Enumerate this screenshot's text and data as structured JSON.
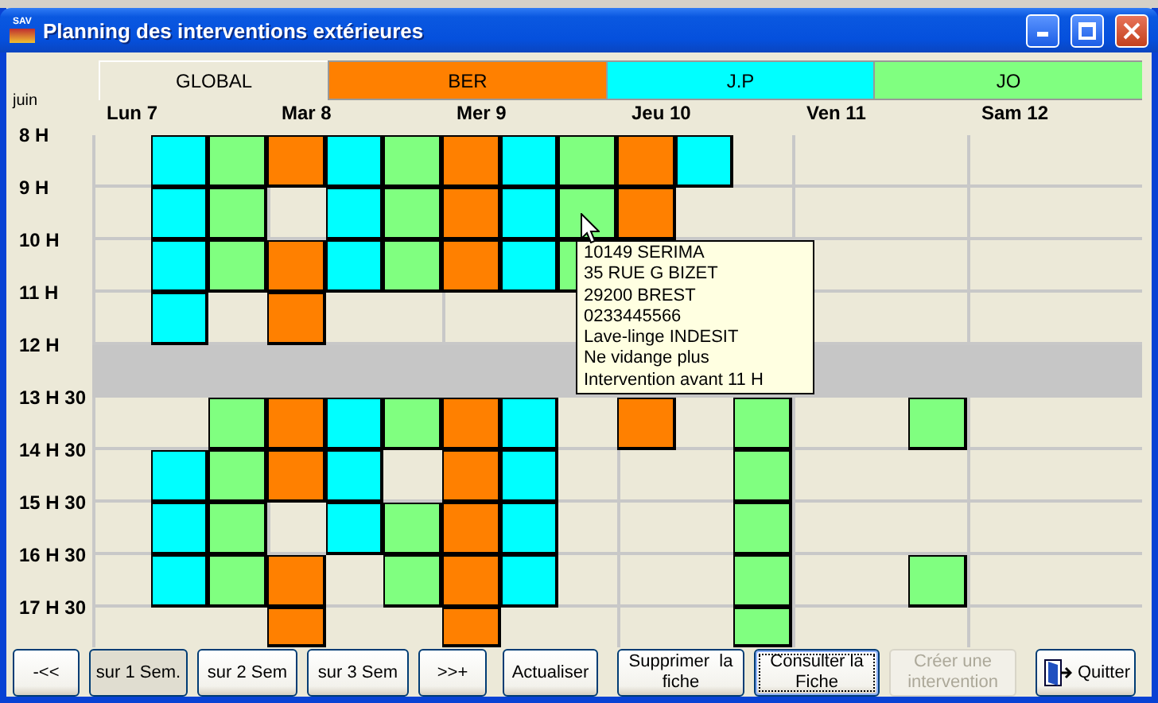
{
  "window": {
    "title": "Planning des interventions extérieures",
    "app_icon": "SAV"
  },
  "tabs": [
    {
      "label": "GLOBAL",
      "selected": true
    },
    {
      "label": "BER",
      "selected": false,
      "color": "#ff8000"
    },
    {
      "label": "J.P",
      "selected": false,
      "color": "#00ffff"
    },
    {
      "label": "JO",
      "selected": false,
      "color": "#80ff80"
    }
  ],
  "month": "juin",
  "hours": [
    "8 H",
    "9 H",
    "10 H",
    "11 H",
    "12 H",
    "13 H 30",
    "14 H 30",
    "15 H 30",
    "16 H 30",
    "17 H 30"
  ],
  "days": [
    {
      "label": "Lun 7",
      "rows": [
        [
          null,
          {
            "color": "#00ffff"
          },
          {
            "color": "#80ff80"
          }
        ],
        [
          null,
          {
            "color": "#00ffff"
          },
          {
            "color": "#80ff80"
          }
        ],
        [
          null,
          {
            "color": "#00ffff"
          },
          {
            "color": "#80ff80"
          }
        ],
        [
          null,
          {
            "color": "#00ffff"
          },
          null
        ],
        [
          null,
          null,
          {
            "color": "#80ff80"
          }
        ],
        [
          null,
          {
            "color": "#00ffff"
          },
          {
            "color": "#80ff80"
          }
        ],
        [
          null,
          {
            "color": "#00ffff"
          },
          {
            "color": "#80ff80"
          }
        ],
        [
          null,
          {
            "color": "#00ffff"
          },
          {
            "color": "#80ff80"
          }
        ],
        [
          null,
          null,
          null
        ]
      ]
    },
    {
      "label": "Mar 8",
      "rows": [
        [
          {
            "color": "#ff8000"
          },
          {
            "color": "#00ffff"
          },
          {
            "color": "#80ff80"
          }
        ],
        [
          null,
          {
            "color": "#00ffff"
          },
          {
            "color": "#80ff80"
          }
        ],
        [
          {
            "color": "#ff8000"
          },
          {
            "color": "#00ffff"
          },
          {
            "color": "#80ff80"
          }
        ],
        [
          {
            "color": "#ff8000"
          },
          null,
          null
        ],
        [
          {
            "color": "#ff8000"
          },
          {
            "color": "#00ffff"
          },
          {
            "color": "#80ff80"
          }
        ],
        [
          {
            "color": "#ff8000"
          },
          {
            "color": "#00ffff"
          },
          null
        ],
        [
          null,
          {
            "color": "#00ffff"
          },
          {
            "color": "#80ff80"
          }
        ],
        [
          {
            "color": "#ff8000"
          },
          null,
          {
            "color": "#80ff80"
          }
        ],
        [
          {
            "color": "#ff8000"
          },
          null,
          null
        ]
      ]
    },
    {
      "label": "Mer 9",
      "rows": [
        [
          {
            "color": "#ff8000"
          },
          {
            "color": "#00ffff"
          },
          {
            "color": "#80ff80"
          }
        ],
        [
          {
            "color": "#ff8000"
          },
          {
            "color": "#00ffff"
          },
          {
            "color": "#80ff80"
          }
        ],
        [
          {
            "color": "#ff8000"
          },
          {
            "color": "#00ffff"
          },
          {
            "color": "#80ff80"
          }
        ],
        [
          null,
          null,
          null
        ],
        [
          {
            "color": "#ff8000"
          },
          {
            "color": "#00ffff"
          },
          null
        ],
        [
          {
            "color": "#ff8000"
          },
          {
            "color": "#00ffff"
          },
          null
        ],
        [
          {
            "color": "#ff8000"
          },
          {
            "color": "#00ffff"
          },
          null
        ],
        [
          {
            "color": "#ff8000"
          },
          {
            "color": "#00ffff"
          },
          null
        ],
        [
          {
            "color": "#ff8000"
          },
          null,
          null
        ]
      ]
    },
    {
      "label": "Jeu 10",
      "rows": [
        [
          {
            "color": "#ff8000"
          },
          {
            "color": "#00ffff"
          },
          null
        ],
        [
          {
            "color": "#ff8000"
          },
          null,
          null
        ],
        [
          null,
          null,
          null
        ],
        [
          null,
          null,
          null
        ],
        [
          {
            "color": "#ff8000"
          },
          null,
          {
            "color": "#80ff80"
          }
        ],
        [
          null,
          null,
          {
            "color": "#80ff80"
          }
        ],
        [
          null,
          null,
          {
            "color": "#80ff80"
          }
        ],
        [
          null,
          null,
          {
            "color": "#80ff80"
          }
        ],
        [
          null,
          null,
          {
            "color": "#80ff80"
          }
        ]
      ]
    },
    {
      "label": "Ven 11",
      "rows": [
        [
          null,
          null,
          null
        ],
        [
          null,
          null,
          null
        ],
        [
          null,
          null,
          null
        ],
        [
          null,
          null,
          null
        ],
        [
          null,
          null,
          {
            "color": "#80ff80"
          }
        ],
        [
          null,
          null,
          null
        ],
        [
          null,
          null,
          null
        ],
        [
          null,
          null,
          {
            "color": "#80ff80"
          }
        ],
        [
          null,
          null,
          null
        ]
      ]
    },
    {
      "label": "Sam 12",
      "rows": [
        [
          null,
          null,
          null
        ],
        [
          null,
          null,
          null
        ],
        [
          null,
          null,
          null
        ],
        [
          null,
          null,
          null
        ],
        [
          null,
          null,
          null
        ],
        [
          null,
          null,
          null
        ],
        [
          null,
          null,
          null
        ],
        [
          null,
          null,
          null
        ],
        [
          null,
          null,
          null
        ]
      ]
    }
  ],
  "tooltip": {
    "lines": [
      "10149 SERIMA",
      "35 RUE G BIZET",
      "29200 BREST",
      "0233445566",
      "Lave-linge INDESIT",
      "Ne vidange plus",
      "Intervention avant 11 H"
    ]
  },
  "buttons": [
    {
      "label": "-<<",
      "pressed": false,
      "disabled": false
    },
    {
      "label": "sur 1 Sem.",
      "pressed": true,
      "disabled": false
    },
    {
      "label": "sur 2 Sem",
      "pressed": false,
      "disabled": false
    },
    {
      "label": "sur 3 Sem",
      "pressed": false,
      "disabled": false
    },
    {
      "label": ">>+",
      "pressed": false,
      "disabled": false
    },
    {
      "label": "Actualiser",
      "pressed": false,
      "disabled": false
    },
    {
      "label": "Supprimer  la fiche",
      "pressed": false,
      "disabled": false
    },
    {
      "label": "Consulter la Fiche",
      "pressed": false,
      "disabled": false,
      "focused": true
    },
    {
      "label": "Créer une intervention",
      "pressed": false,
      "disabled": true
    },
    {
      "label": "Quitter",
      "pressed": false,
      "disabled": false,
      "kind": "exit"
    }
  ]
}
